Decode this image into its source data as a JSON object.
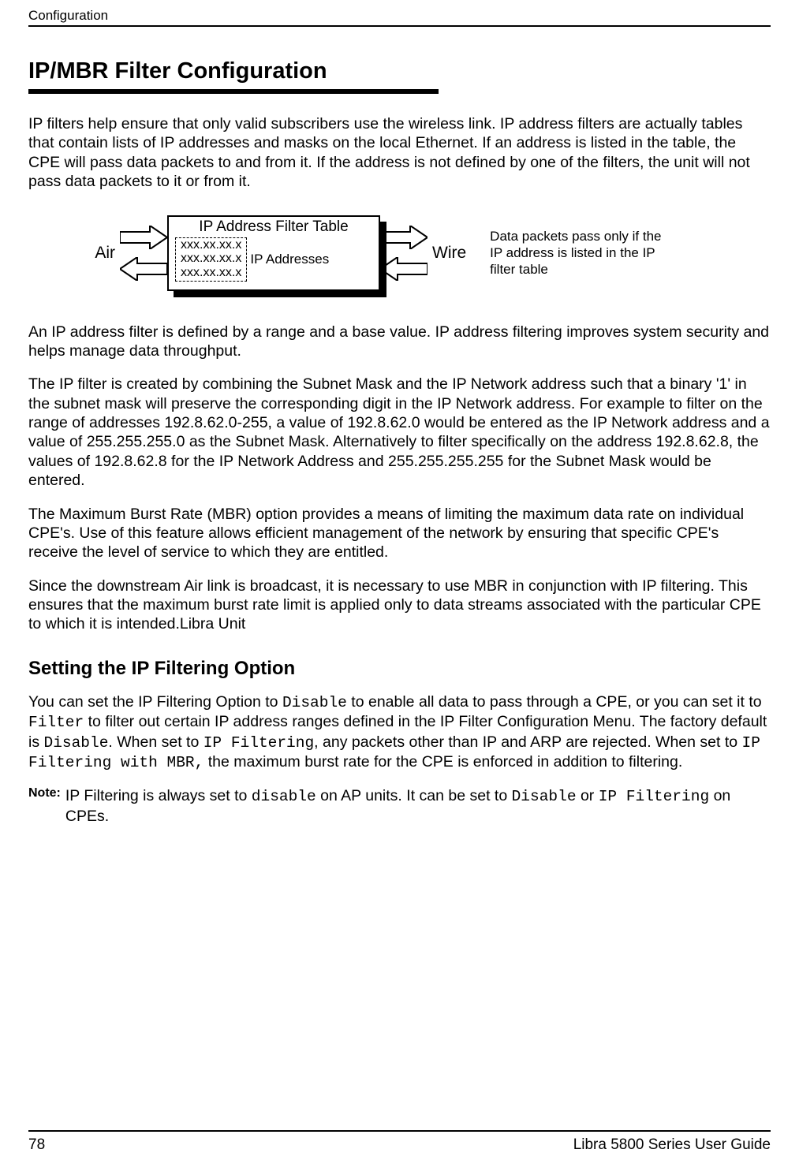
{
  "header": {
    "running": "Configuration"
  },
  "title": "IP/MBR Filter Configuration",
  "p1": "IP filters help ensure that only valid subscribers use the wireless link. IP address filters are actually tables that contain lists of IP addresses and masks on the local Ethernet. If an address is listed in the table, the CPE will pass data packets to and from it. If the address is not defined by one of the filters, the unit will not pass data packets to it or from it.",
  "diagram": {
    "air": "Air",
    "wire": "Wire",
    "box_title": "IP Address Filter Table",
    "row1": "xxx.xx.xx.x",
    "row2": "xxx.xx.xx.x",
    "row3": "xxx.xx.xx.x",
    "ip_label": "IP Addresses",
    "info": "Data packets pass only if the IP address is listed in the IP filter table"
  },
  "p2": "An IP address filter is defined by a range and a base value. IP address filtering improves system security and helps manage data throughput.",
  "p3": "The IP filter is created by combining the Subnet Mask and the IP Network address such that a binary '1' in the subnet mask will preserve the corresponding digit in the IP Network address. For example to filter on the range of addresses 192.8.62.0-255, a value of 192.8.62.0 would be entered as the IP Network address and a value of 255.255.255.0 as the Subnet Mask. Alternatively to filter specifically on the address 192.8.62.8, the values of 192.8.62.8 for the IP Network Address and 255.255.255.255 for the Subnet Mask would be entered.",
  "p4": "The Maximum Burst Rate (MBR) option provides a means of limiting the maximum data rate on individual CPE's. Use of this feature allows efficient management of the network by ensuring that specific CPE's receive the level of service to which they are entitled.",
  "p5": "Since the downstream Air link is broadcast, it is necessary to use MBR in conjunction with IP filtering. This ensures that the maximum burst rate limit is applied only to data streams associated with the particular CPE to which it is intended.Libra Unit",
  "subhead": "Setting the IP Filtering Option",
  "p6a": "You can set the IP Filtering Option to ",
  "p6b": "Disable",
  "p6c": " to enable all data to pass through a CPE, or you can set it to ",
  "p6d": "Filter",
  "p6e": " to filter out certain IP address ranges defined in the IP Filter Configuration Menu. The factory default is ",
  "p6f": "Disable",
  "p6g": ". When set to ",
  "p6h": "IP Filtering",
  "p6i": ", any packets other than IP and ARP are rejected. When set to ",
  "p6j": "IP Filtering with MBR,",
  "p6k": "  the maximum burst rate for the CPE is enforced in addition to filtering.",
  "note": {
    "label": "Note:",
    "a": "IP Filtering is always set to ",
    "b": "disable",
    "c": " on AP units. It can be set to ",
    "d": "Disable",
    "e": " or ",
    "f": "IP Filtering",
    "g": " on CPEs."
  },
  "footer": {
    "page": "78",
    "doc": "Libra 5800 Series User Guide"
  }
}
